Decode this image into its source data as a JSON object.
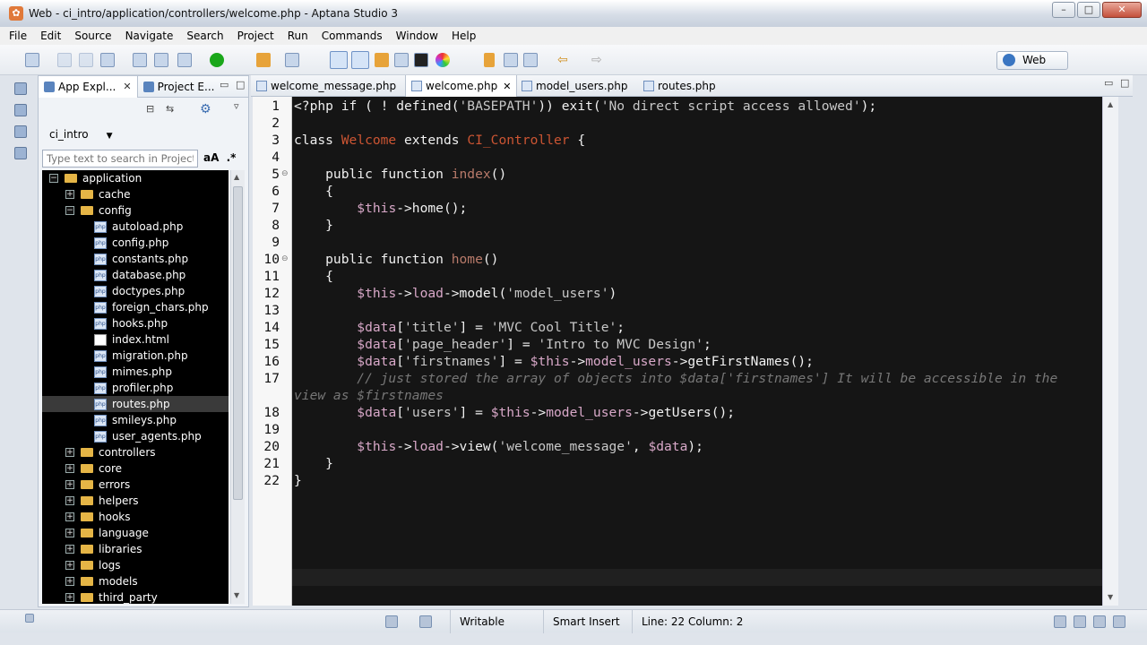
{
  "window": {
    "title": "Web - ci_intro/application/controllers/welcome.php - Aptana Studio 3",
    "minimize": "–",
    "maximize": "□",
    "close": "✕"
  },
  "menu": [
    "File",
    "Edit",
    "Source",
    "Navigate",
    "Search",
    "Project",
    "Run",
    "Commands",
    "Window",
    "Help"
  ],
  "perspective": {
    "label": "Web"
  },
  "explorer": {
    "tabs": [
      {
        "label": "App Expl...",
        "close": "✕"
      },
      {
        "label": "Project E..."
      }
    ],
    "project": "ci_intro",
    "search_placeholder": "Type text to search in Project",
    "case_toggle": "aA",
    "regex_toggle": ".*",
    "tree": [
      {
        "label": "application",
        "type": "folder",
        "toggle": "−",
        "level": 0
      },
      {
        "label": "cache",
        "type": "folder",
        "toggle": "+",
        "level": 1
      },
      {
        "label": "config",
        "type": "folder",
        "toggle": "−",
        "level": 1
      },
      {
        "label": "autoload.php",
        "type": "php",
        "level": 2
      },
      {
        "label": "config.php",
        "type": "php",
        "level": 2
      },
      {
        "label": "constants.php",
        "type": "php",
        "level": 2
      },
      {
        "label": "database.php",
        "type": "php",
        "level": 2
      },
      {
        "label": "doctypes.php",
        "type": "php",
        "level": 2
      },
      {
        "label": "foreign_chars.php",
        "type": "php",
        "level": 2
      },
      {
        "label": "hooks.php",
        "type": "php",
        "level": 2
      },
      {
        "label": "index.html",
        "type": "html",
        "level": 2
      },
      {
        "label": "migration.php",
        "type": "php",
        "level": 2
      },
      {
        "label": "mimes.php",
        "type": "php",
        "level": 2
      },
      {
        "label": "profiler.php",
        "type": "php",
        "level": 2
      },
      {
        "label": "routes.php",
        "type": "php",
        "level": 2,
        "selected": true
      },
      {
        "label": "smileys.php",
        "type": "php",
        "level": 2
      },
      {
        "label": "user_agents.php",
        "type": "php",
        "level": 2
      },
      {
        "label": "controllers",
        "type": "folder",
        "toggle": "+",
        "level": 1
      },
      {
        "label": "core",
        "type": "folder",
        "toggle": "+",
        "level": 1
      },
      {
        "label": "errors",
        "type": "folder",
        "toggle": "+",
        "level": 1
      },
      {
        "label": "helpers",
        "type": "folder",
        "toggle": "+",
        "level": 1
      },
      {
        "label": "hooks",
        "type": "folder",
        "toggle": "+",
        "level": 1
      },
      {
        "label": "language",
        "type": "folder",
        "toggle": "+",
        "level": 1
      },
      {
        "label": "libraries",
        "type": "folder",
        "toggle": "+",
        "level": 1
      },
      {
        "label": "logs",
        "type": "folder",
        "toggle": "+",
        "level": 1
      },
      {
        "label": "models",
        "type": "folder",
        "toggle": "+",
        "level": 1
      },
      {
        "label": "third_party",
        "type": "folder",
        "toggle": "+",
        "level": 1
      }
    ]
  },
  "editor_tabs": [
    {
      "label": "welcome_message.php",
      "active": false
    },
    {
      "label": "welcome.php",
      "active": true,
      "close": "✕"
    },
    {
      "label": "model_users.php",
      "active": false
    },
    {
      "label": "routes.php",
      "active": false
    }
  ],
  "code_lines": [
    {
      "n": "1",
      "spans": [
        [
          "k",
          "<?php if ( ! defined("
        ],
        [
          "str",
          "'BASEPATH'"
        ],
        [
          "k",
          ")) exit("
        ],
        [
          "str",
          "'No direct script access allowed'"
        ],
        [
          "k",
          ");"
        ]
      ]
    },
    {
      "n": "2",
      "spans": []
    },
    {
      "n": "3",
      "spans": [
        [
          "k",
          "class "
        ],
        [
          "cls",
          "Welcome"
        ],
        [
          "k",
          " extends "
        ],
        [
          "cls",
          "CI_Controller"
        ],
        [
          "k",
          " {"
        ]
      ]
    },
    {
      "n": "4",
      "spans": []
    },
    {
      "n": "5",
      "fold": true,
      "spans": [
        [
          "k",
          "    public function "
        ],
        [
          "fn",
          "index"
        ],
        [
          "k",
          "()"
        ]
      ]
    },
    {
      "n": "6",
      "spans": [
        [
          "k",
          "    {"
        ]
      ]
    },
    {
      "n": "7",
      "spans": [
        [
          "k",
          "        "
        ],
        [
          "var",
          "$this"
        ],
        [
          "k",
          "->home();"
        ]
      ]
    },
    {
      "n": "8",
      "spans": [
        [
          "k",
          "    }"
        ]
      ]
    },
    {
      "n": "9",
      "spans": []
    },
    {
      "n": "10",
      "fold": true,
      "spans": [
        [
          "k",
          "    public function "
        ],
        [
          "fn",
          "home"
        ],
        [
          "k",
          "()"
        ]
      ]
    },
    {
      "n": "11",
      "spans": [
        [
          "k",
          "    {"
        ]
      ]
    },
    {
      "n": "12",
      "spans": [
        [
          "k",
          "        "
        ],
        [
          "var",
          "$this"
        ],
        [
          "k",
          "->"
        ],
        [
          "var",
          "load"
        ],
        [
          "k",
          "->model("
        ],
        [
          "str",
          "'model_users'"
        ],
        [
          "k",
          ")"
        ]
      ]
    },
    {
      "n": "13",
      "spans": []
    },
    {
      "n": "14",
      "spans": [
        [
          "k",
          "        "
        ],
        [
          "var",
          "$data"
        ],
        [
          "k",
          "["
        ],
        [
          "str",
          "'title'"
        ],
        [
          "k",
          "] = "
        ],
        [
          "str",
          "'MVC Cool Title'"
        ],
        [
          "k",
          ";"
        ]
      ]
    },
    {
      "n": "15",
      "spans": [
        [
          "k",
          "        "
        ],
        [
          "var",
          "$data"
        ],
        [
          "k",
          "["
        ],
        [
          "str",
          "'page_header'"
        ],
        [
          "k",
          "] = "
        ],
        [
          "str",
          "'Intro to MVC Design'"
        ],
        [
          "k",
          ";"
        ]
      ]
    },
    {
      "n": "16",
      "spans": [
        [
          "k",
          "        "
        ],
        [
          "var",
          "$data"
        ],
        [
          "k",
          "["
        ],
        [
          "str",
          "'firstnames'"
        ],
        [
          "k",
          "] = "
        ],
        [
          "var",
          "$this"
        ],
        [
          "k",
          "->"
        ],
        [
          "var",
          "model_users"
        ],
        [
          "k",
          "->getFirstNames();"
        ]
      ]
    },
    {
      "n": "17",
      "spans": [
        [
          "cmt",
          "        // just stored the array of objects into $data['firstnames'] It will be accessible in the"
        ]
      ]
    },
    {
      "n": "",
      "spans": [
        [
          "cmt",
          "view as $firstnames"
        ]
      ]
    },
    {
      "n": "18",
      "spans": [
        [
          "k",
          "        "
        ],
        [
          "var",
          "$data"
        ],
        [
          "k",
          "["
        ],
        [
          "str",
          "'users'"
        ],
        [
          "k",
          "] = "
        ],
        [
          "var",
          "$this"
        ],
        [
          "k",
          "->"
        ],
        [
          "var",
          "model_users"
        ],
        [
          "k",
          "->getUsers();"
        ]
      ]
    },
    {
      "n": "19",
      "spans": []
    },
    {
      "n": "20",
      "spans": [
        [
          "k",
          "        "
        ],
        [
          "var",
          "$this"
        ],
        [
          "k",
          "->"
        ],
        [
          "var",
          "load"
        ],
        [
          "k",
          "->view("
        ],
        [
          "str",
          "'welcome_message'"
        ],
        [
          "k",
          ", "
        ],
        [
          "var",
          "$data"
        ],
        [
          "k",
          ");"
        ]
      ]
    },
    {
      "n": "21",
      "spans": [
        [
          "k",
          "    }"
        ]
      ]
    },
    {
      "n": "22",
      "spans": [
        [
          "k",
          "}"
        ]
      ]
    }
  ],
  "status": {
    "writable": "Writable",
    "insert_mode": "Smart Insert",
    "position": "Line: 22 Column: 2"
  }
}
